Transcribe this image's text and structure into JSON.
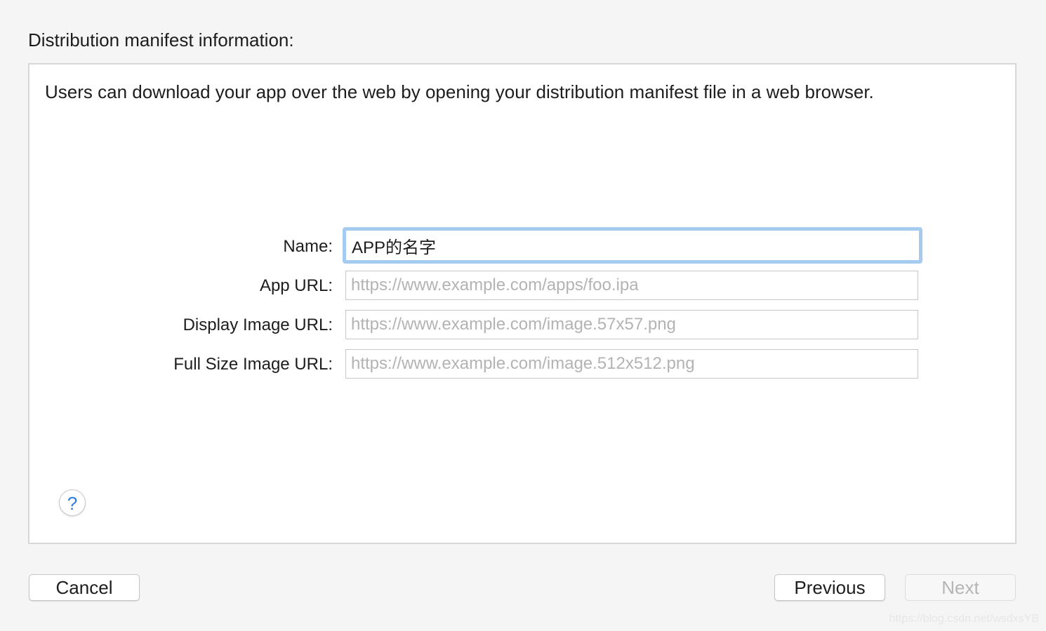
{
  "page": {
    "title": "Distribution manifest information:"
  },
  "panel": {
    "description": "Users can download your app over the web by opening your distribution manifest file in a web browser."
  },
  "form": {
    "name": {
      "label": "Name:",
      "value": "APP的名字",
      "placeholder": ""
    },
    "app_url": {
      "label": "App URL:",
      "value": "",
      "placeholder": "https://www.example.com/apps/foo.ipa"
    },
    "display_image_url": {
      "label": "Display Image URL:",
      "value": "",
      "placeholder": "https://www.example.com/image.57x57.png"
    },
    "full_size_image_url": {
      "label": "Full Size Image URL:",
      "value": "",
      "placeholder": "https://www.example.com/image.512x512.png"
    }
  },
  "help": {
    "icon": "question-icon",
    "glyph": "?"
  },
  "footer": {
    "cancel_label": "Cancel",
    "previous_label": "Previous",
    "next_label": "Next",
    "next_enabled": false
  },
  "watermark": "https://blog.csdn.net/wsdxsYB",
  "colors": {
    "focus_ring": "#a6cbf0",
    "help_accent": "#2f7ce0",
    "placeholder": "#b3b3b3"
  }
}
